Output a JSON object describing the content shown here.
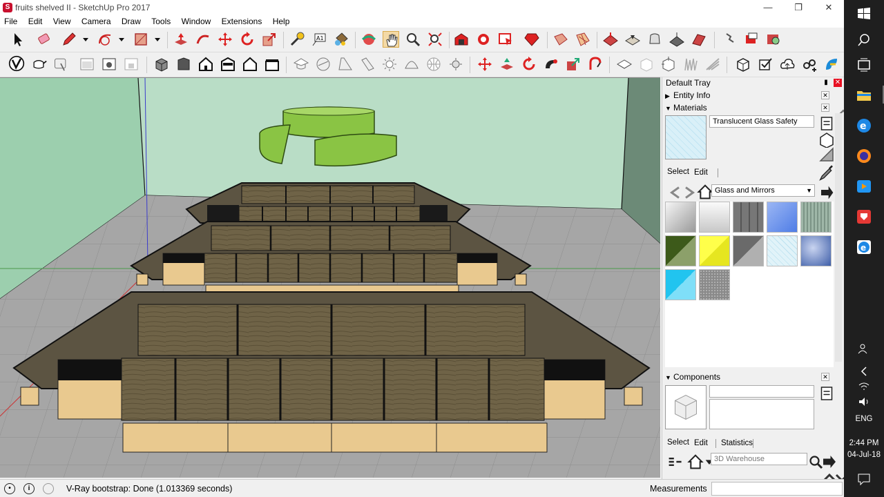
{
  "window": {
    "title": "fruits shelved II - SketchUp Pro 2017",
    "app_icon": "sketchup-icon",
    "controls": [
      "minimize",
      "restore",
      "close"
    ]
  },
  "menu": [
    "File",
    "Edit",
    "View",
    "Camera",
    "Draw",
    "Tools",
    "Window",
    "Extensions",
    "Help"
  ],
  "toolbar_icons": {
    "row1": [
      "select-arrow-icon",
      "eraser-icon",
      "pencil-icon",
      "arc-icon",
      "rectangle-icon",
      "push-pull-icon",
      "follow-me-icon",
      "move-icon",
      "rotate-icon",
      "scale-icon",
      "tape-measure-icon",
      "text-icon",
      "paint-bucket-icon",
      "orbit-icon",
      "pan-icon",
      "zoom-icon",
      "zoom-extents-icon",
      "warehouse-icon",
      "extension-warehouse-icon",
      "layout-icon",
      "ruby-icon",
      "section-plane-icon",
      "section-icon",
      "sandbox-icon",
      "stamp-icon",
      "drape-icon",
      "add-detail-icon",
      "flip-icon",
      "solid-tools-icon",
      "intersect-icon"
    ],
    "row2": [
      "vray-render-icon",
      "vray-teapot-icon",
      "vray-interactive-icon",
      "frame-buffer-icon",
      "render-window-icon",
      "lock-icon",
      "iso-view-icon",
      "top-view-icon",
      "front-view-icon",
      "right-view-icon",
      "back-view-icon",
      "left-view-icon",
      "hat-icon",
      "sphere-icon",
      "cone-light-icon",
      "spot-light-icon",
      "sun-light-icon",
      "dome-icon",
      "grid-sphere-icon",
      "omni-light-icon",
      "move-axes-icon",
      "push-icon",
      "rotate-red-icon",
      "rubber-icon",
      "scale-red-icon",
      "magnet-icon",
      "polygon-icon",
      "cube-outline-icon",
      "cube-gizmo-icon",
      "grass-icon",
      "fur-icon",
      "box-icon",
      "check-box-icon",
      "cloud-upload-icon",
      "link-icon",
      "skp-icon"
    ]
  },
  "status": {
    "message": "V-Ray bootstrap: Done (1.013369 seconds)",
    "measurements_label": "Measurements",
    "measurements_value": ""
  },
  "tray": {
    "title": "Default Tray",
    "panels": {
      "entity_info": "Entity Info",
      "materials": "Materials",
      "components": "Components"
    },
    "materials": {
      "current_name": "Translucent Glass Safety",
      "tabs": [
        "Select",
        "Edit"
      ],
      "collection": "Glass and Mirrors",
      "swatches": [
        {
          "name": "chrome-1",
          "color": "#b5b5b5"
        },
        {
          "name": "chrome-2",
          "color": "#d8d8d8"
        },
        {
          "name": "stone-grey",
          "color": "#6b6b6b"
        },
        {
          "name": "blue-glass",
          "color": "#6e95e8"
        },
        {
          "name": "green-pattern",
          "color": "#8fa89a"
        },
        {
          "name": "dark-green",
          "color": "#3d5a1a"
        },
        {
          "name": "yellow",
          "color": "#f5f530"
        },
        {
          "name": "grey-gradient",
          "color": "#8c8c8c"
        },
        {
          "name": "translucent-glass",
          "color": "#cfe9f3"
        },
        {
          "name": "sky-clouds",
          "color": "#4f6fb8"
        },
        {
          "name": "cyan",
          "color": "#21c4ef"
        },
        {
          "name": "granite",
          "color": "#a9a9a9"
        }
      ]
    },
    "components": {
      "tabs": [
        "Select",
        "Edit",
        "Statistics"
      ],
      "search_placeholder": "3D Warehouse"
    }
  },
  "taskbar": {
    "icons": [
      "windows-start-icon",
      "search-icon",
      "task-view-icon",
      "file-explorer-icon",
      "edge-icon",
      "firefox-icon",
      "media-player-icon",
      "sketchup-taskbar-icon",
      "edge-2-icon"
    ],
    "tray_icons": [
      "people-icon",
      "chevron-left-icon",
      "wifi-icon",
      "volume-icon"
    ],
    "language": "ENG",
    "time": "2:44 PM",
    "date": "04-Jul-18",
    "notification_icon": "notification-icon"
  },
  "colors": {
    "accent": "#e81123",
    "background_wall": "#b9ddc6",
    "floor": "#a7a7a7",
    "wood": "#e9c98f",
    "green_ring": "#89c440"
  }
}
